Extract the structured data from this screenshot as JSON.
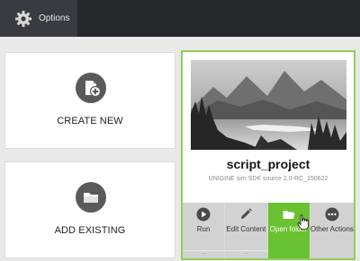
{
  "topbar": {
    "options_label": "Options",
    "icon": "gear-icon",
    "background": "#26272b"
  },
  "actions": {
    "create_label": "CREATE NEW",
    "create_icon": "new-document-plus-icon",
    "add_label": "ADD EXISTING",
    "add_icon": "folder-icon"
  },
  "project": {
    "title": "script_project",
    "subtitle": "UNIGINE sim SDK source 2.0-RC_150622",
    "thumbnail": "mountain-lake-landscape",
    "highlight_color": "#8dd05a",
    "tools": [
      {
        "label": "Run",
        "icon": "play-icon",
        "sub": "..."
      },
      {
        "label": "Edit Content",
        "icon": "pencil-icon",
        "sub": "..."
      },
      {
        "label": "Open folder",
        "icon": "open-folder-icon",
        "sub": "",
        "active": true,
        "color": "#69c231"
      },
      {
        "label": "Other Actions",
        "icon": "more-dots-icon",
        "sub": ""
      }
    ]
  }
}
